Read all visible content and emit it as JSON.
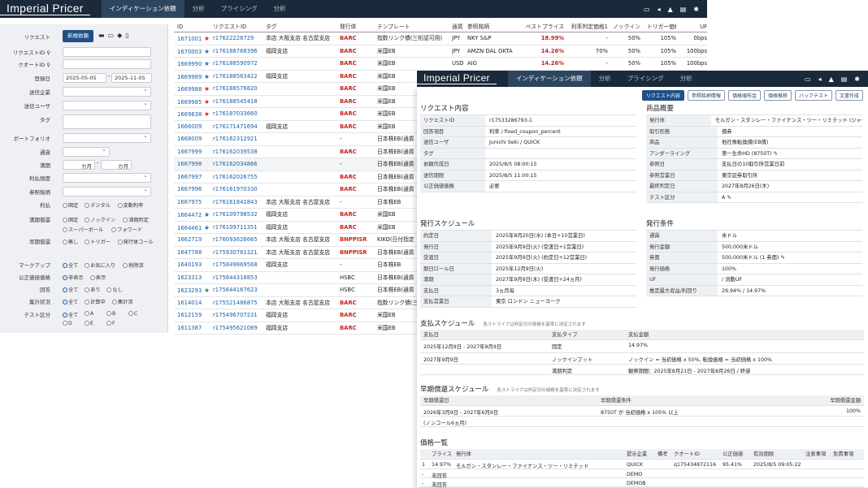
{
  "app": {
    "logo": "Imperial Pricer",
    "tabs": [
      "インディケーション依頼",
      "分析",
      "プライシング",
      "分析"
    ]
  },
  "sidebar": {
    "request_label": "リクエスト",
    "request_button": "新規依頼",
    "fields": [
      {
        "label": "リクエストID"
      },
      {
        "label": "クオートID"
      },
      {
        "label": "登録日"
      },
      {
        "label": "送信企業"
      },
      {
        "label": "送信ユーザ"
      },
      {
        "label": "タグ"
      },
      {
        "label": "ポートフォリオ"
      },
      {
        "label": "通貨"
      },
      {
        "label": "満期"
      },
      {
        "label": "利払頻度"
      },
      {
        "label": "参照銘柄"
      }
    ],
    "date_from": "2025-05-05",
    "date_to": "2025-11-05",
    "month_from": "カ月",
    "month_to": "カ月",
    "range_sep": "-",
    "coupon": {
      "label": "利払",
      "options": [
        "固定",
        "デジタル",
        "変動利率"
      ]
    },
    "redemption": {
      "label": "満期償還",
      "options": [
        "固定",
        "ノックイン",
        "満期判定",
        "スーパーボール",
        "フォワード"
      ]
    },
    "early": {
      "label": "早期償還",
      "options": [
        "無し",
        "トリガー",
        "発行体コール"
      ]
    },
    "markup": {
      "label": "マークアップ",
      "options": [
        "全て",
        "お気に入り",
        "削除済"
      ]
    },
    "pub": {
      "label": "公正価値価格",
      "options": [
        "非表示",
        "表示"
      ]
    },
    "answer": {
      "label": "回答",
      "options": [
        "全て",
        "あり",
        "なし"
      ]
    },
    "agg": {
      "label": "集計状況",
      "options": [
        "全て",
        "計算中",
        "集計済"
      ]
    },
    "test": {
      "label": "テスト区分",
      "options": [
        "全て",
        "A",
        "B",
        "C",
        "D",
        "E",
        "F"
      ]
    }
  },
  "table": {
    "headers": [
      "ID",
      "リクエストID",
      "タグ",
      "発行体",
      "テンプレート",
      "通貨",
      "参照銘柄",
      "ベストプライス",
      "利率判定価格1",
      "ノックイン",
      "トリガー価格",
      "UF"
    ],
    "rows": [
      {
        "id": "1671001",
        "star": "r",
        "req": "r17622226729",
        "tag": "本店 大阪支店 名古屋支店",
        "issuer": "BARC",
        "tpl": "指数リンク債(三桁認可用)",
        "ccy": "JPY",
        "ref": "NKY S&P",
        "best": "18.99%",
        "rate": "-",
        "ki": "50%",
        "trig": "105%",
        "uf": "0bps"
      },
      {
        "id": "1670003",
        "star": "b",
        "req": "r176188768396",
        "tag": "福岡支店",
        "issuer": "BARC",
        "tpl": "米国EB",
        "ccy": "JPY",
        "ref": "AMZN DAL OKTA",
        "best": "14.26%",
        "rate": "70%",
        "ki": "50%",
        "trig": "105%",
        "uf": "100bps"
      },
      {
        "id": "1669990",
        "star": "b",
        "req": "r176188590972",
        "tag": "",
        "issuer": "BARC",
        "tpl": "米国EB",
        "ccy": "USD",
        "ref": "AIG",
        "best": "14.26%",
        "rate": "-",
        "ki": "50%",
        "trig": "105%",
        "uf": "100bps"
      },
      {
        "id": "1669989",
        "star": "b",
        "req": "r176188563422",
        "tag": "福岡支店",
        "issuer": "BARC",
        "tpl": "米国EB",
        "ccy": "",
        "ref": "",
        "best": "",
        "rate": "",
        "ki": "",
        "trig": "",
        "uf": ""
      },
      {
        "id": "1669988",
        "star": "r",
        "req": "r176188576820",
        "tag": "",
        "issuer": "BARC",
        "tpl": "米国EB",
        "ccy": "",
        "ref": "",
        "best": "",
        "rate": "",
        "ki": "",
        "trig": "",
        "uf": ""
      },
      {
        "id": "1669985",
        "star": "r",
        "req": "r176188545418",
        "tag": "",
        "issuer": "BARC",
        "tpl": "米国EB",
        "ccy": "",
        "ref": "",
        "best": "",
        "rate": "",
        "ki": "",
        "trig": "",
        "uf": ""
      },
      {
        "id": "1669638",
        "star": "r",
        "req": "r176187033660",
        "tag": "",
        "issuer": "BARC",
        "tpl": "米国EB",
        "ccy": "",
        "ref": "",
        "best": "",
        "rate": "",
        "ki": "",
        "trig": "",
        "uf": ""
      },
      {
        "id": "1666009",
        "star": "",
        "req": "r176171471694",
        "tag": "福岡支店",
        "issuer": "BARC",
        "tpl": "米国EB",
        "ccy": "",
        "ref": "",
        "best": "",
        "rate": "",
        "ki": "",
        "trig": "",
        "uf": ""
      },
      {
        "id": "1668009",
        "star": "",
        "req": "r176162312921",
        "tag": "",
        "issuer": "-",
        "tpl": "日本株EB(通貨",
        "ccy": "",
        "ref": "",
        "best": "",
        "rate": "",
        "ki": "",
        "trig": "",
        "uf": ""
      },
      {
        "id": "1667999",
        "star": "",
        "req": "r176162039538",
        "tag": "",
        "issuer": "BARC",
        "tpl": "日本株EB(通貨",
        "ccy": "",
        "ref": "",
        "best": "",
        "rate": "",
        "ki": "",
        "trig": "",
        "uf": ""
      },
      {
        "id": "1667998",
        "star": "",
        "req": "r176162034866",
        "tag": "",
        "issuer": "-",
        "tpl": "日本株EB(通貨",
        "ccy": "",
        "ref": "",
        "best": "",
        "rate": "",
        "ki": "",
        "trig": "",
        "uf": ""
      },
      {
        "id": "1667997",
        "star": "",
        "req": "r176162026755",
        "tag": "",
        "issuer": "BARC",
        "tpl": "日本株EB(通貨",
        "ccy": "",
        "ref": "",
        "best": "",
        "rate": "",
        "ki": "",
        "trig": "",
        "uf": ""
      },
      {
        "id": "1667996",
        "star": "",
        "req": "r176161970330",
        "tag": "",
        "issuer": "BARC",
        "tpl": "日本株EB(通貨",
        "ccy": "",
        "ref": "",
        "best": "",
        "rate": "",
        "ki": "",
        "trig": "",
        "uf": ""
      },
      {
        "id": "1667975",
        "star": "",
        "req": "r176161841843",
        "tag": "本店 大阪支店 名古屋支店",
        "issuer": "-",
        "tpl": "日本株EB",
        "ccy": "",
        "ref": "",
        "best": "",
        "rate": "",
        "ki": "",
        "trig": "",
        "uf": ""
      },
      {
        "id": "1664472",
        "star": "b",
        "req": "r176109798532",
        "tag": "福岡支店",
        "issuer": "BARC",
        "tpl": "米国EB",
        "ccy": "",
        "ref": "",
        "best": "",
        "rate": "",
        "ki": "",
        "trig": "",
        "uf": ""
      },
      {
        "id": "1664461",
        "star": "b",
        "req": "r176109711351",
        "tag": "福岡支店",
        "issuer": "BARC",
        "tpl": "米国EB",
        "ccy": "",
        "ref": "",
        "best": "",
        "rate": "",
        "ki": "",
        "trig": "",
        "uf": ""
      },
      {
        "id": "1662719",
        "star": "",
        "req": "r176093626665",
        "tag": "本店 大阪支店 名古屋支店",
        "issuer": "BNPPISR",
        "tpl": "KIKO(日付指定",
        "ccy": "",
        "ref": "",
        "best": "",
        "rate": "",
        "ki": "",
        "trig": "",
        "uf": ""
      },
      {
        "id": "1647788",
        "star": "",
        "req": "r175930761321",
        "tag": "本店 大阪支店 名古屋支店",
        "issuer": "BNPPISR",
        "tpl": "日本株EB(通貨",
        "ccy": "",
        "ref": "",
        "best": "",
        "rate": "",
        "ki": "",
        "trig": "",
        "uf": ""
      },
      {
        "id": "1640193",
        "star": "",
        "req": "r175849869568",
        "tag": "福岡支店",
        "issuer": "-",
        "tpl": "日本株EB",
        "ccy": "",
        "ref": "",
        "best": "",
        "rate": "",
        "ki": "",
        "trig": "",
        "uf": ""
      },
      {
        "id": "1623313",
        "star": "",
        "req": "r175644318853",
        "tag": "",
        "issuer": "HSBC",
        "tpl": "日本株EB(通貨",
        "ccy": "",
        "ref": "",
        "best": "",
        "rate": "",
        "ki": "",
        "trig": "",
        "uf": ""
      },
      {
        "id": "1623293",
        "star": "g",
        "req": "r175644167623",
        "tag": "",
        "issuer": "HSBC",
        "tpl": "日本株EB(通貨",
        "ccy": "",
        "ref": "",
        "best": "",
        "rate": "",
        "ki": "",
        "trig": "",
        "uf": ""
      },
      {
        "id": "1614014",
        "star": "",
        "req": "r175521486875",
        "tag": "本店 大阪支店 名古屋支店",
        "issuer": "BARC",
        "tpl": "指数リンク債(三",
        "ccy": "",
        "ref": "",
        "best": "",
        "rate": "",
        "ki": "",
        "trig": "",
        "uf": ""
      },
      {
        "id": "1612159",
        "star": "",
        "req": "r175496707231",
        "tag": "福岡支店",
        "issuer": "BARC",
        "tpl": "米国EB",
        "ccy": "",
        "ref": "",
        "best": "",
        "rate": "",
        "ki": "",
        "trig": "",
        "uf": ""
      },
      {
        "id": "1611387",
        "star": "",
        "req": "r175495621089",
        "tag": "福岡支店",
        "issuer": "BARC",
        "tpl": "米国EB",
        "ccy": "",
        "ref": "",
        "best": "",
        "rate": "",
        "ki": "",
        "trig": "",
        "uf": ""
      }
    ]
  },
  "detail": {
    "buttons": [
      "リクエスト内容",
      "参照銘柄情報",
      "価格頒布金",
      "価格推移",
      "バックテスト",
      "文書作成"
    ],
    "req_title": "リクエスト内容",
    "req": [
      [
        "リクエストID",
        "r17533286793-1"
      ],
      [
        "回答項目",
        "利率 / fixed_coupon_percent"
      ],
      [
        "送信ユーザ",
        "Junichi Seki / QUICK"
      ],
      [
        "タグ",
        ""
      ],
      [
        "依頼作成日",
        "2025/8/5 08:00:15"
      ],
      [
        "送信期限",
        "2025/8/5 11:00:15"
      ],
      [
        "公正価値価格",
        "必要"
      ]
    ],
    "prod_title": "商品概要",
    "prod": [
      [
        "発行体",
        "モルガン・スタンレー・ファイナンス・ツー・リミテッド (ジャージー)"
      ],
      [
        "取引形態",
        "債券"
      ],
      [
        "商品",
        "他社株転換債(EB債)"
      ],
      [
        "アンダーライング",
        "第一生命HD (8750T)"
      ],
      [
        "参照日",
        "支払日の10取引所営業日前"
      ],
      [
        "参照営業日",
        "東京証券取引所"
      ],
      [
        "最終判定日",
        "2027年8月26日(木)"
      ],
      [
        "テスト区分",
        "A"
      ]
    ],
    "sched_title": "発行スケジュール",
    "sched": [
      [
        "約定日",
        "2025年8月20日(水) (本日+10営業日)"
      ],
      [
        "発行日",
        "2025年9月9日(火) (受渡日+1営業日)"
      ],
      [
        "受渡日",
        "2025年9月9日(火) (約定日+12営業日)"
      ],
      [
        "期日ロール日",
        "2025年12月9日(火)"
      ],
      [
        "満期",
        "2027年9月9日(木) (受渡日+24ヵ月)"
      ],
      [
        "支払日",
        "3ヵ月毎"
      ],
      [
        "支払営業日",
        "東京 ロンドン ニューヨーク"
      ]
    ],
    "issue_title": "発行条件",
    "issue": [
      [
        "通貨",
        "米ドル"
      ],
      [
        "発行金額",
        "500,000米ドル"
      ],
      [
        "券面",
        "500,000米ドル (1 券面)"
      ],
      [
        "発行価格",
        "100%"
      ],
      [
        "UF",
        "/ 流動UF"
      ],
      [
        "推定最大収益/利回り",
        "29.94% / 14.97%"
      ]
    ],
    "pay_title": "支払スケジュール",
    "pay_note": "各ストライクは判定日の価格を基準に決定されます",
    "pay_headers": [
      "支払日",
      "支払タイプ",
      "支払金額"
    ],
    "pay_rows": [
      [
        "2025年12月9日 - 2027年9月9日",
        "固定",
        "14.97%",
        ""
      ],
      [
        "2027年9月9日",
        "ノックインプット",
        "ノックイン = 当初価格 x 50%, 転換価格 = 当初価格 x 100%",
        ""
      ],
      [
        "",
        "満期判定",
        "",
        "観察期間：2025年8月21日 - 2027年8月26日 / 終値"
      ]
    ],
    "early_title": "早期償還スケジュール",
    "early_note": "各ストライクは判定日の価格を基準に決定されます",
    "early_headers": [
      "早期償還日",
      "早期償還条件",
      "早期償還金額"
    ],
    "early_rows": [
      [
        "2026年3月9日 - 2027年6月9日",
        "8750T が 当初価格 x 105% 以上",
        "100%"
      ],
      [
        "(ノンコール6ヵ月)",
        "",
        ""
      ]
    ],
    "price_title": "価格一覧",
    "price_headers": [
      "プライス",
      "発行体",
      "提示企業",
      "備考",
      "クオートID",
      "公正価値",
      "有効期限",
      "注意事項",
      "免責事項"
    ],
    "price_rows": [
      [
        "1",
        "14.97%",
        "モルガン・スタンレー・ファイナンス・ツー・リミテッド",
        "QUICK",
        "",
        "q175434872116",
        "95.41%",
        "2025/8/5 09:05:22"
      ],
      [
        "-",
        "未回答",
        "",
        "DEMO",
        "",
        "",
        "",
        ""
      ],
      [
        "-",
        "未回答",
        "",
        "DEMOB",
        "",
        "",
        "",
        ""
      ]
    ]
  }
}
